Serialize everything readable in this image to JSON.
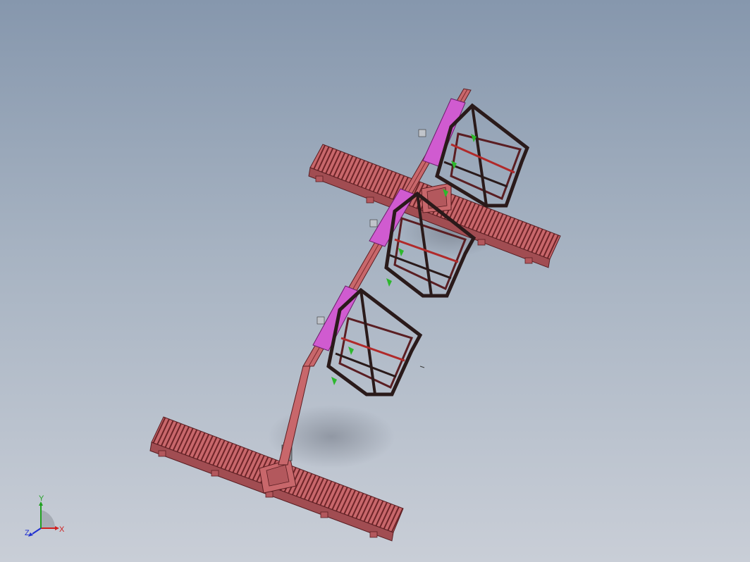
{
  "viewport": {
    "background_top": "#8697ad",
    "background_bottom": "#c9ced7"
  },
  "model": {
    "frame_color": "#c8676b",
    "frame_dark": "#7a2a2e",
    "accent_color": "#d05bd0",
    "fixture_color": "#2a1a1a",
    "highlight_color": "#2db82d"
  },
  "triad": {
    "x_label": "X",
    "y_label": "Y",
    "z_label": "Z",
    "x_color": "#d02020",
    "y_color": "#20a020",
    "z_color": "#2030d0"
  }
}
